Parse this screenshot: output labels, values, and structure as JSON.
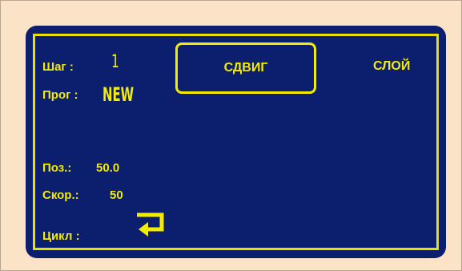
{
  "step": {
    "label": "Шаг :",
    "value": "1"
  },
  "program": {
    "label": "Прог :",
    "value": "NEW"
  },
  "mode_button": {
    "label": "СДВИГ"
  },
  "layer_button": {
    "label": "СЛОЙ"
  },
  "position": {
    "label": "Поз.:",
    "value": "50.0"
  },
  "speed": {
    "label": "Скор.:",
    "value": "50"
  },
  "cycle": {
    "label": "Цикл :",
    "icon": "return-arrow-icon"
  },
  "colors": {
    "background": "#fbe3c8",
    "screen": "#0b1f6e",
    "accent": "#f4ec00"
  }
}
